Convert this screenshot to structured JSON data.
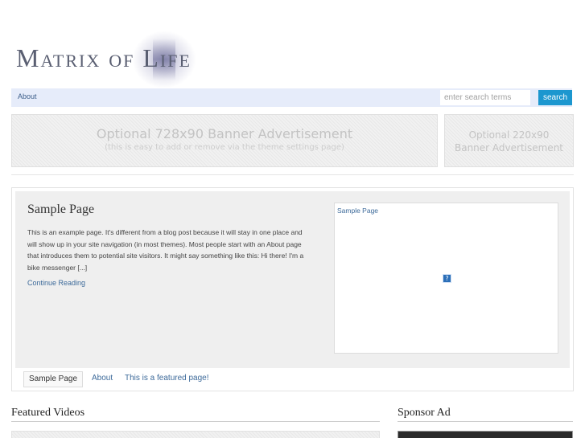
{
  "site": {
    "logo_text": "Matrix of Life"
  },
  "nav": {
    "items": [
      {
        "label": "About"
      }
    ],
    "search": {
      "placeholder": "enter search terms",
      "button_label": "search"
    }
  },
  "banners": {
    "large": {
      "line1": "Optional 728x90 Banner Advertisement",
      "line2": "(this is easy to add or remove via the theme settings page)"
    },
    "small": {
      "line1": "Optional 220x90",
      "line2": "Banner Advertisement"
    }
  },
  "featured": {
    "post_title": "Sample Page",
    "excerpt": "This is an example page. It's different from a blog post because it will stay in one place and will show up in your site navigation (in most themes). Most people start with an About page that introduces them to potential site visitors. It might say something like this: Hi there! I'm a bike messenger [...]",
    "continue_label": "Continue Reading",
    "image_caption": "Sample Page",
    "broken_image_glyph": "?",
    "tabs": [
      {
        "label": "Sample Page"
      },
      {
        "label": "About"
      },
      {
        "label": "This is a featured page!"
      }
    ]
  },
  "sections": {
    "featured_videos": "Featured Videos",
    "sponsor_ad": "Sponsor Ad"
  },
  "colors": {
    "nav_bg": "#e6ecfa",
    "search_button": "#1c97cf",
    "link": "#3d6a9a"
  }
}
